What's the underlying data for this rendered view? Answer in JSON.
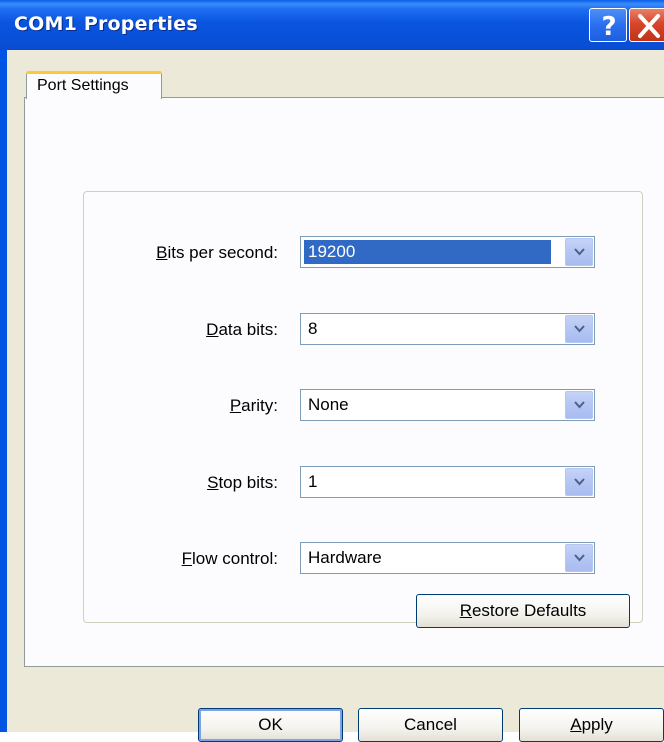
{
  "window": {
    "title": "COM1 Properties",
    "help_glyph": "?",
    "help_icon": "help-icon",
    "close_icon": "close-icon",
    "titlebar_color": "#0054e3",
    "client_color": "#ece9d8"
  },
  "tabs": [
    {
      "label": "Port Settings",
      "active": true
    }
  ],
  "fields": {
    "bits_per_second": {
      "label_mnemonic": "B",
      "label_rest": "its per second:",
      "value": "19200",
      "selected": true
    },
    "data_bits": {
      "label_mnemonic": "D",
      "label_rest": "ata bits:",
      "value": "8"
    },
    "parity": {
      "label_mnemonic": "P",
      "label_rest": "arity:",
      "value": "None"
    },
    "stop_bits": {
      "label_mnemonic": "S",
      "label_rest": "top bits:",
      "value": "1"
    },
    "flow_control": {
      "label_mnemonic": "F",
      "label_rest": "low control:",
      "value": "Hardware"
    }
  },
  "buttons": {
    "restore": {
      "mnemonic": "R",
      "rest": "estore Defaults"
    },
    "ok": {
      "label": "OK"
    },
    "cancel": {
      "label": "Cancel"
    },
    "apply": {
      "mnemonic": "A",
      "rest": "pply"
    }
  },
  "colors": {
    "selection": "#316ac5",
    "combo_border": "#7f9db9",
    "tab_highlight": "#ffc83c"
  }
}
